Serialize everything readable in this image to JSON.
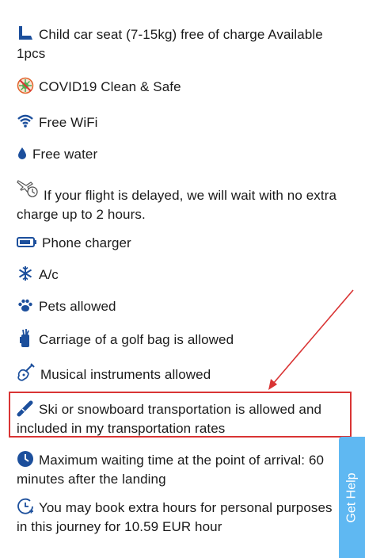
{
  "features": [
    {
      "icon": "child-seat-icon",
      "text": "Child car seat (7-15kg) free of charge Available 1pcs"
    },
    {
      "icon": "covid-virus-icon",
      "text": "COVID19 Clean & Safe"
    },
    {
      "icon": "wifi-icon",
      "text": "Free WiFi"
    },
    {
      "icon": "water-drop-icon",
      "text": "Free water"
    },
    {
      "icon": "plane-clock-icon",
      "text": "If your flight is delayed, we will wait with no extra charge up to 2 hours."
    },
    {
      "icon": "battery-icon",
      "text": "Phone charger"
    },
    {
      "icon": "snowflake-icon",
      "text": "A/c"
    },
    {
      "icon": "paw-icon",
      "text": "Pets allowed"
    },
    {
      "icon": "golf-bag-icon",
      "text": "Carriage of a golf bag is allowed"
    },
    {
      "icon": "guitar-icon",
      "text": "Musical instruments allowed"
    },
    {
      "icon": "ski-icon",
      "text": "Ski or snowboard transportation is allowed and included in my transportation rates"
    },
    {
      "icon": "clock-icon",
      "text": "Maximum waiting time at the point of arrival: 60 minutes after the landing"
    },
    {
      "icon": "extra-hours-clock-icon",
      "text": "You may book extra hours for personal purposes in this journey for 10.59 EUR hour"
    }
  ],
  "get_help_label": "Get Help",
  "colors": {
    "icon": "#1c4f9c",
    "highlight": "#d93434",
    "get_help_bg": "#5fb8f2"
  }
}
